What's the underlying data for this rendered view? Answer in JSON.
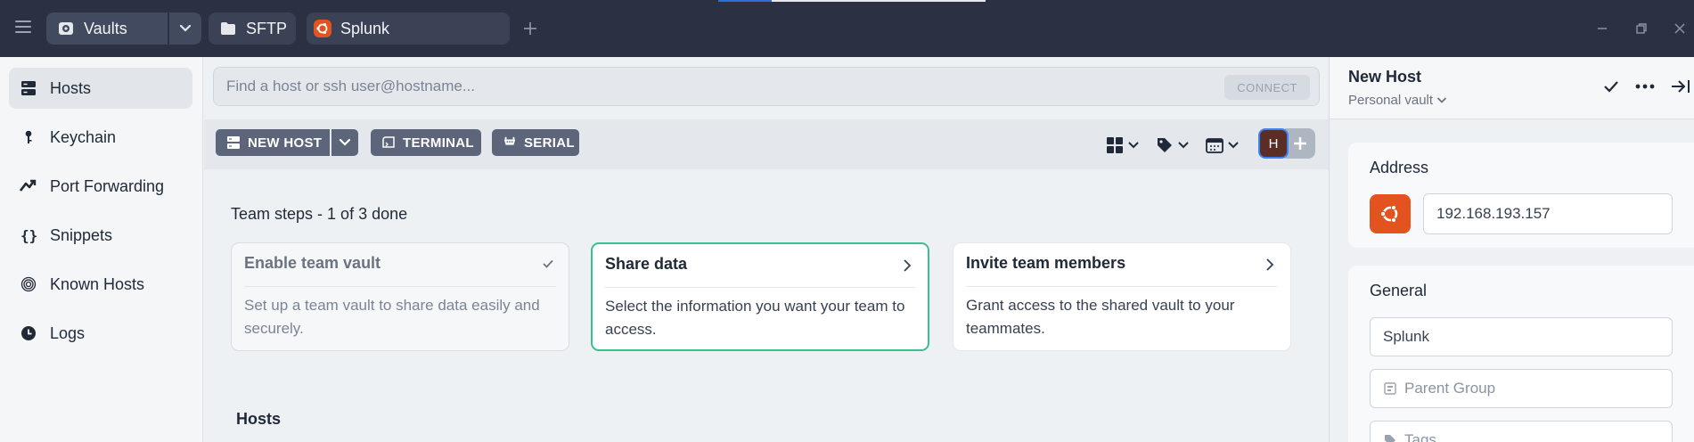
{
  "titlebar": {
    "tabs": [
      {
        "label": "Vaults",
        "icon": "vault-icon"
      },
      {
        "label": "SFTP",
        "icon": "folder-icon"
      },
      {
        "label": "Splunk",
        "icon": "ubuntu-icon"
      }
    ],
    "accent": "#2f6fd6"
  },
  "sidebar": {
    "items": [
      {
        "label": "Hosts",
        "icon": "hosts-icon",
        "active": true
      },
      {
        "label": "Keychain",
        "icon": "key-icon"
      },
      {
        "label": "Port Forwarding",
        "icon": "port-forwarding-icon"
      },
      {
        "label": "Snippets",
        "icon": "snippets-icon"
      },
      {
        "label": "Known Hosts",
        "icon": "fingerprint-icon"
      },
      {
        "label": "Logs",
        "icon": "clock-icon"
      }
    ]
  },
  "search": {
    "placeholder": "Find a host or ssh user@hostname...",
    "connect_label": "CONNECT"
  },
  "toolbar": {
    "new_host_label": "NEW HOST",
    "terminal_label": "TERMINAL",
    "serial_label": "SERIAL",
    "avatar_initial": "H"
  },
  "team_steps": {
    "title_bold": "Team steps",
    "title_rest": " - 1 of 3 done",
    "cards": [
      {
        "title": "Enable team vault",
        "desc": "Set up a team vault to share data easily and securely.",
        "done": true
      },
      {
        "title": "Share data",
        "desc": "Select the information you want your team to access."
      },
      {
        "title": "Invite team members",
        "desc": "Grant access to the shared vault to your teammates."
      }
    ]
  },
  "hosts_heading": "Hosts",
  "panel": {
    "title": "New Host",
    "vault": "Personal vault",
    "address_title": "Address",
    "address_value": "192.168.193.157",
    "os_color": "#e2531f",
    "general_title": "General",
    "label_value": "Splunk",
    "parent_group_placeholder": "Parent Group",
    "tags_placeholder": "Tags"
  }
}
